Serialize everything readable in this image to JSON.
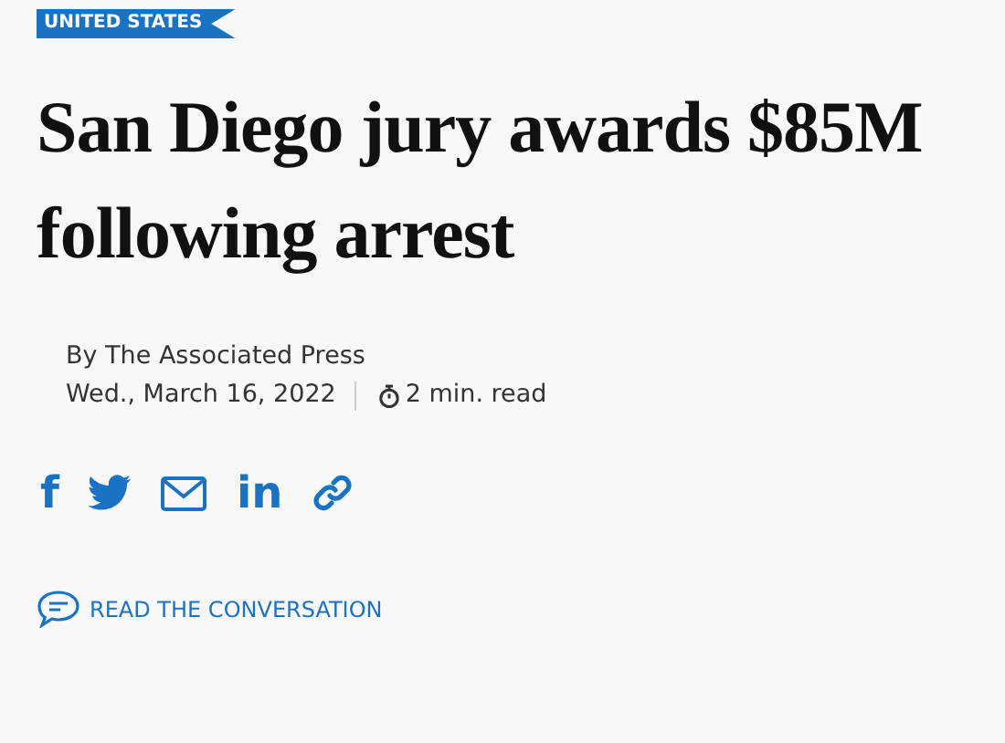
{
  "section_tag": "UNITED STATES",
  "headline_lines": [
    "San Diego jury awards $85M",
    "following arrest"
  ],
  "byline": "By The Associated Press",
  "date": "Wed., March 16, 2022",
  "read_time": "2 min. read",
  "share_buttons": [
    {
      "kind": "glyph",
      "glyph": "f"
    },
    {
      "kind": "bird"
    },
    {
      "kind": "envelope"
    },
    {
      "kind": "glyph",
      "glyph": "in"
    },
    {
      "kind": "chain"
    }
  ],
  "conversation_link": "READ THE CONVERSATION"
}
